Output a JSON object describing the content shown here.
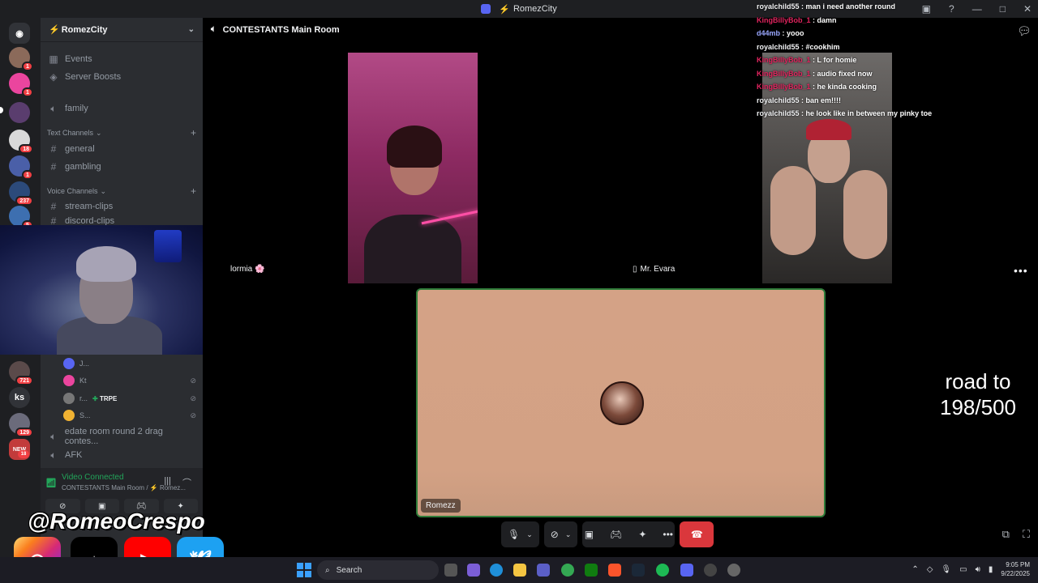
{
  "window": {
    "title": "RomezCity"
  },
  "server": {
    "name": "RomezCity"
  },
  "rail_badges": [
    "1",
    "1",
    "18",
    "1",
    "237",
    "5",
    "721",
    "129",
    "NEW",
    "18"
  ],
  "rail_text_server": "ks",
  "sidebar": {
    "top_items": [
      {
        "label": "Events",
        "icon": "calendar-icon"
      },
      {
        "label": "Server Boosts",
        "icon": "boost-icon"
      },
      {
        "label": "family",
        "icon": "speaker-icon"
      }
    ],
    "text_category": "Text Channels",
    "text_channels": [
      "general",
      "gambling"
    ],
    "voice_category": "Voice Channels",
    "voice_channels": [
      "stream-clips",
      "discord-clips"
    ],
    "voice_users": [
      {
        "name": "J...",
        "badge": ""
      },
      {
        "name": "Kt",
        "badge": ""
      },
      {
        "name": "r...",
        "badge": "TRPE"
      },
      {
        "name": "S...",
        "badge": ""
      }
    ],
    "bottom_channels": [
      {
        "label": "edate room round 2 drag contes...",
        "icon": "speaker-icon"
      },
      {
        "label": "AFK",
        "icon": "speaker-icon"
      }
    ]
  },
  "voice_panel": {
    "status": "Video Connected",
    "subtitle": "CONTESTANTS Main Room / ⚡ Romez...",
    "user_initials": "Romezz"
  },
  "stage": {
    "channel_name": "CONTESTANTS Main Room",
    "participants": [
      {
        "name": "lormia 🌸"
      },
      {
        "name": "Mr. Evara"
      }
    ],
    "spotlight_name": "Romezz"
  },
  "chat": [
    {
      "user": "royalchild55",
      "text": "man i need another round",
      "style": "royal"
    },
    {
      "user": "KingBillyBob_1",
      "text": "damn",
      "style": "king"
    },
    {
      "user": "d44mb",
      "text": "yooo",
      "style": "d44"
    },
    {
      "user": "royalchild55",
      "text": "#cookhim",
      "style": "royal"
    },
    {
      "user": "KingBillyBob_1",
      "text": "L for homie",
      "style": "king"
    },
    {
      "user": "KingBillyBob_1",
      "text": "audio fixed now",
      "style": "king"
    },
    {
      "user": "KingBillyBob_1",
      "text": "he kinda cooking",
      "style": "king"
    },
    {
      "user": "royalchild55",
      "text": "ban em!!!!",
      "style": "royal"
    },
    {
      "user": "royalchild55",
      "text": "he look like in between my pinky toe",
      "style": "royal"
    }
  ],
  "road_text": {
    "line1": "road to",
    "line2": "198/500"
  },
  "overlay": {
    "handle": "@RomeoCrespo",
    "socials": [
      "instagram-icon",
      "tiktok-icon",
      "youtube-icon",
      "twitter-icon"
    ]
  },
  "taskbar": {
    "search_placeholder": "Search",
    "time": "9:05 PM",
    "date": "9/22/2025"
  },
  "colors": {
    "accent": "#5865f2",
    "connected": "#23a55a",
    "end_call": "#da373c",
    "chat_king": "#e0245e"
  }
}
